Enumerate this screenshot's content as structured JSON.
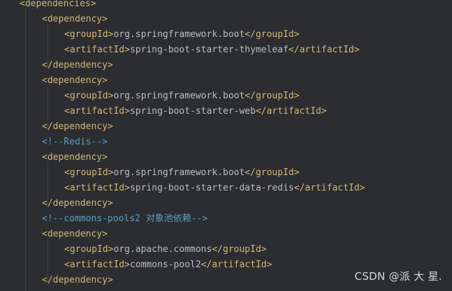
{
  "editor": {
    "lines": [
      {
        "kind": "open",
        "tag": "dependencies"
      },
      {
        "kind": "open",
        "tag": "dependency"
      },
      {
        "kind": "element",
        "tag": "groupId",
        "value": "org.springframework.boot"
      },
      {
        "kind": "element",
        "tag": "artifactId",
        "value": "spring-boot-starter-thymeleaf"
      },
      {
        "kind": "close",
        "tag": "dependency"
      },
      {
        "kind": "open",
        "tag": "dependency"
      },
      {
        "kind": "element",
        "tag": "groupId",
        "value": "org.springframework.boot"
      },
      {
        "kind": "element",
        "tag": "artifactId",
        "value": "spring-boot-starter-web"
      },
      {
        "kind": "close",
        "tag": "dependency"
      },
      {
        "kind": "comment",
        "text": "<!--Redis-->"
      },
      {
        "kind": "open",
        "tag": "dependency"
      },
      {
        "kind": "element",
        "tag": "groupId",
        "value": "org.springframework.boot"
      },
      {
        "kind": "element",
        "tag": "artifactId",
        "value": "spring-boot-starter-data-redis"
      },
      {
        "kind": "close",
        "tag": "dependency"
      },
      {
        "kind": "comment",
        "text": "<!--commons-pools2 对象池依赖-->"
      },
      {
        "kind": "open",
        "tag": "dependency"
      },
      {
        "kind": "element",
        "tag": "groupId",
        "value": "org.apache.commons"
      },
      {
        "kind": "element",
        "tag": "artifactId",
        "value": "commons-pool2"
      },
      {
        "kind": "close",
        "tag": "dependency"
      }
    ]
  },
  "watermark": "CSDN @派 大 星.",
  "colors": {
    "background": "#2b2d30",
    "tag": "#d5b778",
    "text": "#bcbec4",
    "comment": "#5f9ec0"
  }
}
